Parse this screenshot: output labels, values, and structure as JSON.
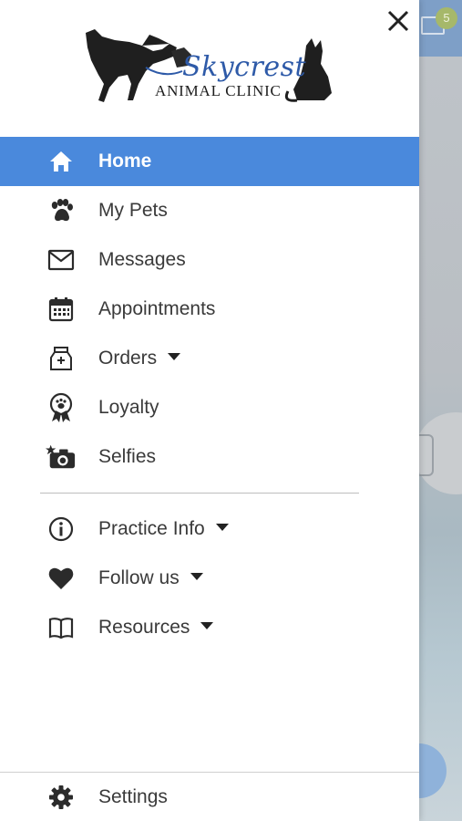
{
  "header": {
    "logo_name": "Skycrest",
    "logo_subtitle": "ANIMAL CLINIC"
  },
  "menu": {
    "items": [
      {
        "label": "Home",
        "icon": "home-icon",
        "active": true
      },
      {
        "label": "My Pets",
        "icon": "paw-icon"
      },
      {
        "label": "Messages",
        "icon": "mail-icon"
      },
      {
        "label": "Appointments",
        "icon": "calendar-icon"
      },
      {
        "label": "Orders",
        "icon": "pet-food-bag-icon",
        "has_dropdown": true
      },
      {
        "label": "Loyalty",
        "icon": "award-ribbon-icon"
      },
      {
        "label": "Selfies",
        "icon": "camera-star-icon"
      }
    ],
    "secondary": [
      {
        "label": "Practice Info",
        "icon": "info-icon",
        "has_dropdown": true
      },
      {
        "label": "Follow us",
        "icon": "heart-icon",
        "has_dropdown": true
      },
      {
        "label": "Resources",
        "icon": "book-icon",
        "has_dropdown": true
      }
    ],
    "settings": {
      "label": "Settings",
      "icon": "gear-icon"
    }
  },
  "background": {
    "message_badge_count": "5"
  },
  "colors": {
    "active_bg": "#4a89dc",
    "text": "#3a3a3a",
    "logo_blue": "#2e5aa8"
  }
}
